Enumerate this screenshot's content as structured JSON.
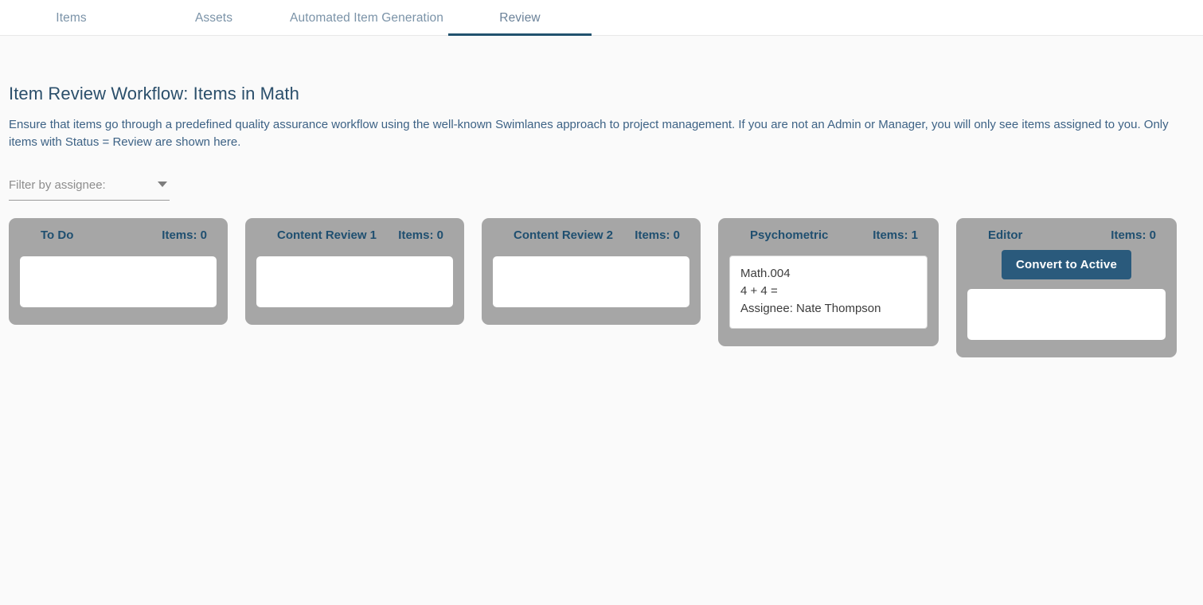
{
  "tabs": [
    {
      "label": "Items",
      "active": false
    },
    {
      "label": "Assets",
      "active": false
    },
    {
      "label": "Automated Item Generation",
      "active": false
    },
    {
      "label": "Review",
      "active": true
    }
  ],
  "page": {
    "title": "Item Review Workflow: Items in Math",
    "description": "Ensure that items go through a predefined quality assurance workflow using the well-known Swimlanes approach to project management. If you are not an Admin or Manager, you will only see items assigned to you. Only items with Status = Review are shown here."
  },
  "filter": {
    "label": "Filter by assignee:",
    "value": "",
    "placeholder": "Filter by assignee:",
    "arrow_icon": "chevron-down-icon",
    "options": [
      "Filter by assignee:"
    ]
  },
  "lanes": [
    {
      "title": "To Do",
      "count_label": "Items: 0",
      "count": 0,
      "button": null,
      "items": []
    },
    {
      "title": "Content Review 1",
      "count_label": "Items: 0",
      "count": 0,
      "button": null,
      "items": []
    },
    {
      "title": "Content Review 2",
      "count_label": "Items: 0",
      "count": 0,
      "button": null,
      "items": []
    },
    {
      "title": "Psychometric",
      "count_label": "Items: 1",
      "count": 1,
      "button": null,
      "items": [
        {
          "code": "Math.004",
          "stem": "4 + 4 =",
          "assignee": "Assignee: Nate Thompson"
        }
      ]
    },
    {
      "title": "Editor",
      "count_label": "Items: 0",
      "count": 0,
      "button": "Convert to Active",
      "items": []
    }
  ],
  "colors": {
    "accent": "#2a5a7c",
    "lane_background": "#a6a6a6",
    "heading": "#2b4f6b",
    "body_text": "#3d6285",
    "page_background": "#fafafa",
    "tab_inactive": "#7b93a8",
    "tab_underline": "#21526e"
  }
}
